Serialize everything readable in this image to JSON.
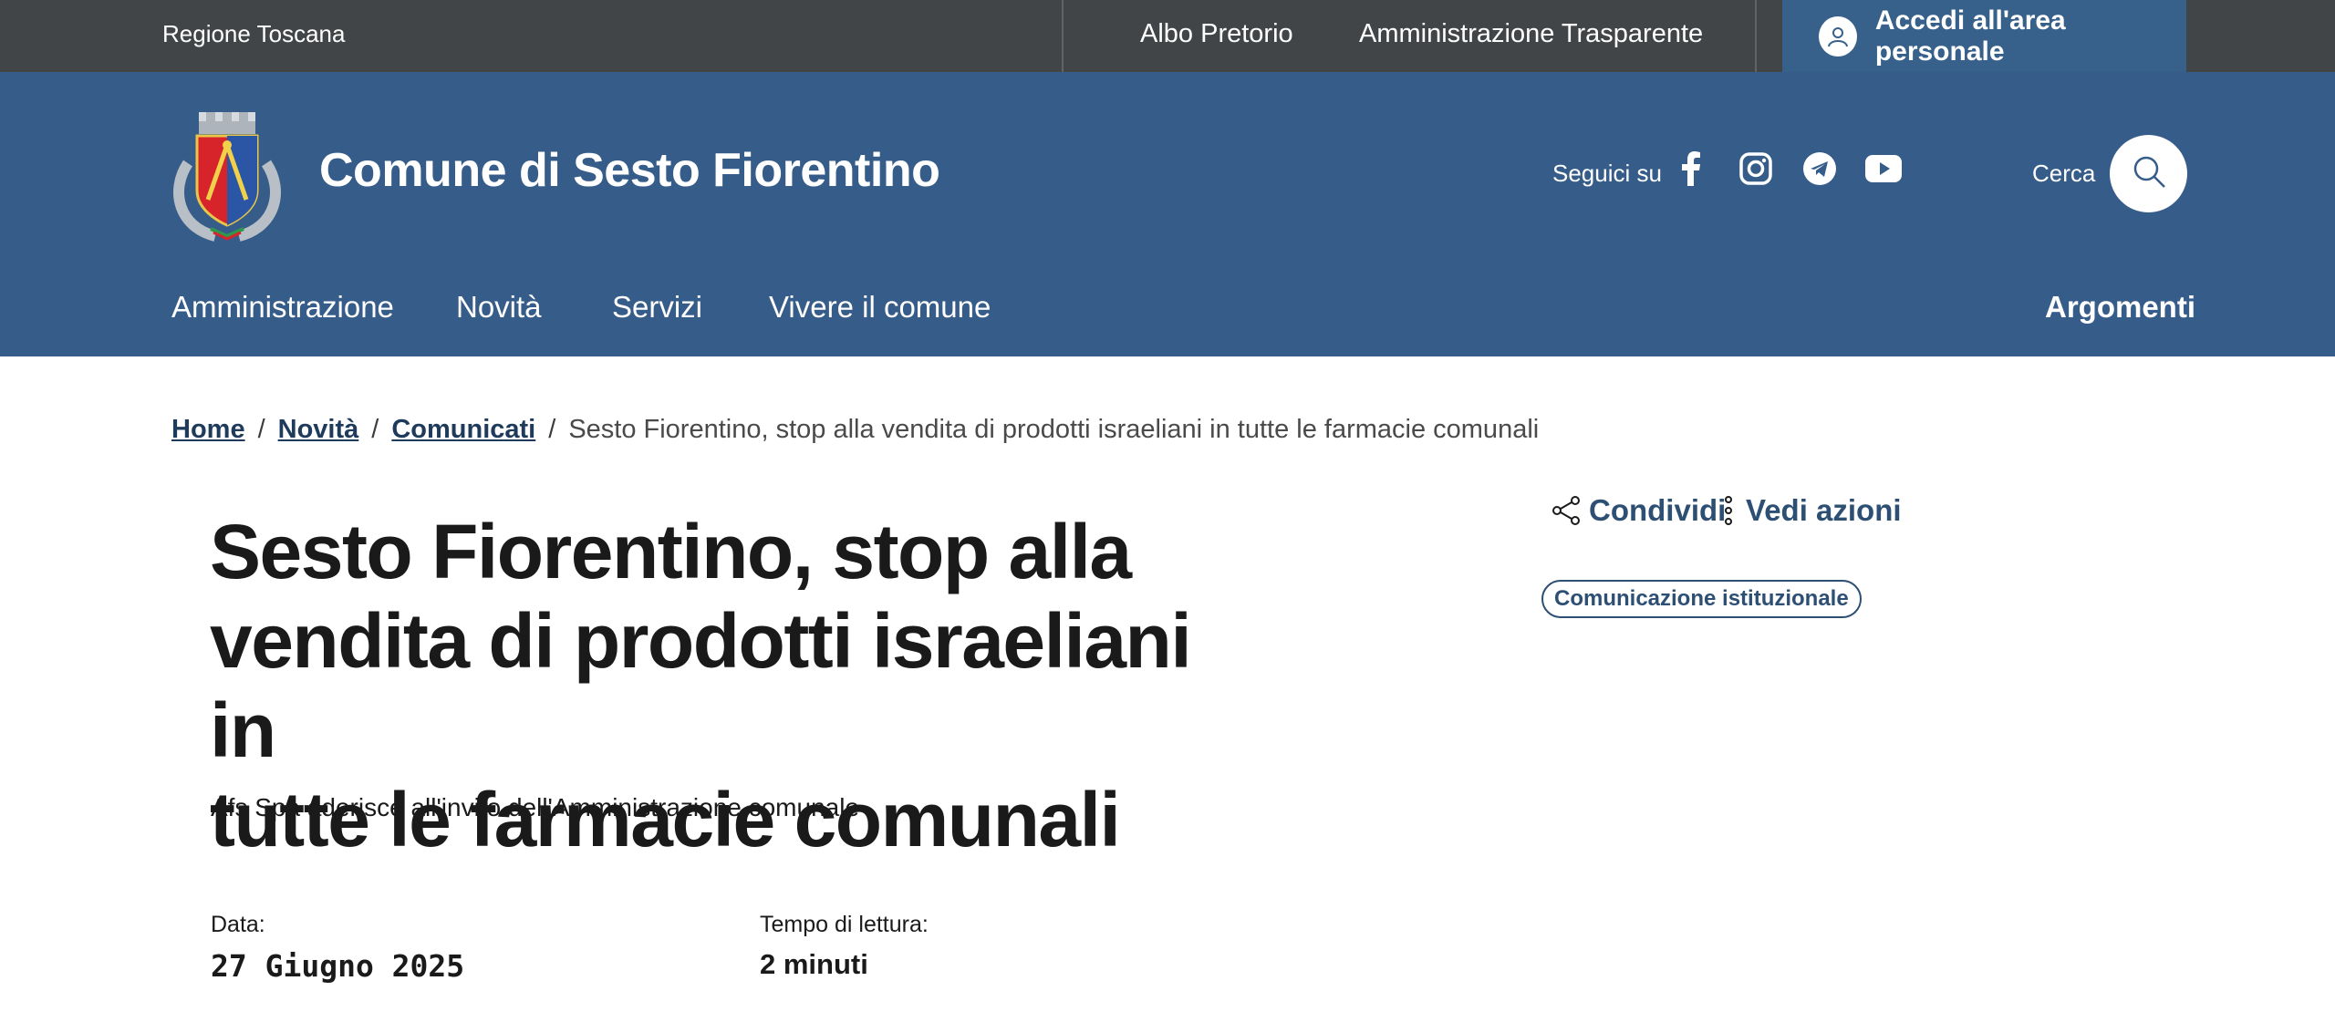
{
  "topbar": {
    "region": "Regione Toscana",
    "links": [
      "Albo Pretorio",
      "Amministrazione Trasparente"
    ],
    "login_label": "Accedi all'area personale"
  },
  "header": {
    "site_title": "Comune di Sesto Fiorentino",
    "follow_label": "Seguici su",
    "social_icons": [
      "facebook-icon",
      "instagram-icon",
      "telegram-icon",
      "youtube-icon"
    ],
    "search_label": "Cerca",
    "nav": [
      "Amministrazione",
      "Novità",
      "Servizi",
      "Vivere il comune"
    ],
    "nav_right": "Argomenti"
  },
  "breadcrumb": {
    "items": [
      "Home",
      "Novità",
      "Comunicati"
    ],
    "current": "Sesto Fiorentino, stop alla vendita di prodotti israeliani in tutte le farmacie comunali"
  },
  "article": {
    "title_lines": [
      "Sesto Fiorentino, stop alla",
      "vendita di prodotti israeliani in",
      "tutte le farmacie comunali"
    ],
    "subtitle": "Afs Spa aderisce all'invito dell'Amministrazione comunale",
    "share_label": "Condividi",
    "actions_label": "Vedi azioni",
    "tag": "Comunicazione istituzionale",
    "date_label": "Data:",
    "date_value": "27 Giugno 2025",
    "reading_label": "Tempo di lettura:",
    "reading_value": "2 minuti"
  },
  "colors": {
    "topbar": "#424547",
    "header": "#365c89",
    "login": "#37608b",
    "accent_text": "#2d4f74"
  }
}
